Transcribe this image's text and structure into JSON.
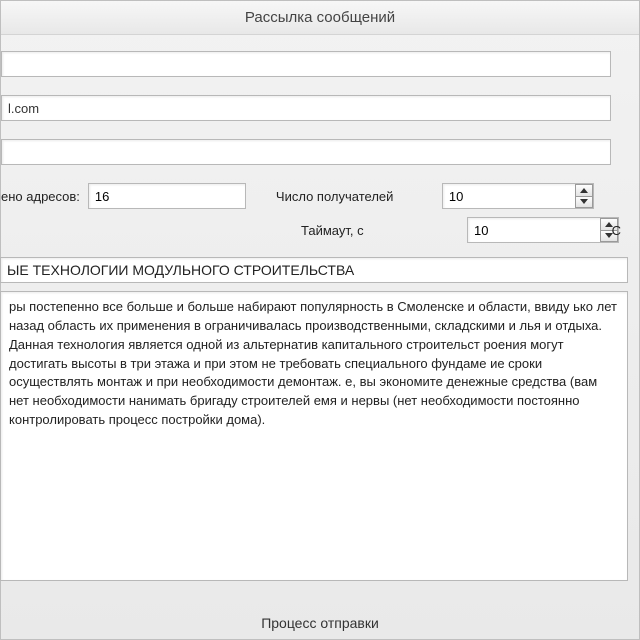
{
  "window": {
    "title": "Рассылка сообщений"
  },
  "fields": {
    "from_value": "",
    "smtp_value": "l.com",
    "list_value": ""
  },
  "addresses": {
    "loaded_label": "ено адресов:",
    "loaded_value": "16",
    "recipients_label": "Число получателей",
    "recipients_value": "10",
    "timeout_label": "Таймаут, с",
    "timeout_value": "10",
    "right_cut": "С"
  },
  "message": {
    "subject": "ЫЕ ТЕХНОЛОГИИ МОДУЛЬНОГО СТРОИТЕЛЬСТВА",
    "body": "ры постепенно все больше и больше набирают популярность в Смоленске и области, ввиду ько лет назад область их применения в ограничивалась производственными, складскими и лья и отдыха. Данная технология является одной из альтернатив капитального строительст роения могут достигать высоты в три этажа и при этом не требовать специального фундаме ие сроки осуществлять монтаж и при необходимости демонтаж.\nе, вы экономите денежные средства (вам нет необходимости нанимать бригаду строителей емя и нервы (нет необходимости постоянно контролировать процесс постройки дома)."
  },
  "footer": {
    "caption": "Процесс отправки"
  }
}
